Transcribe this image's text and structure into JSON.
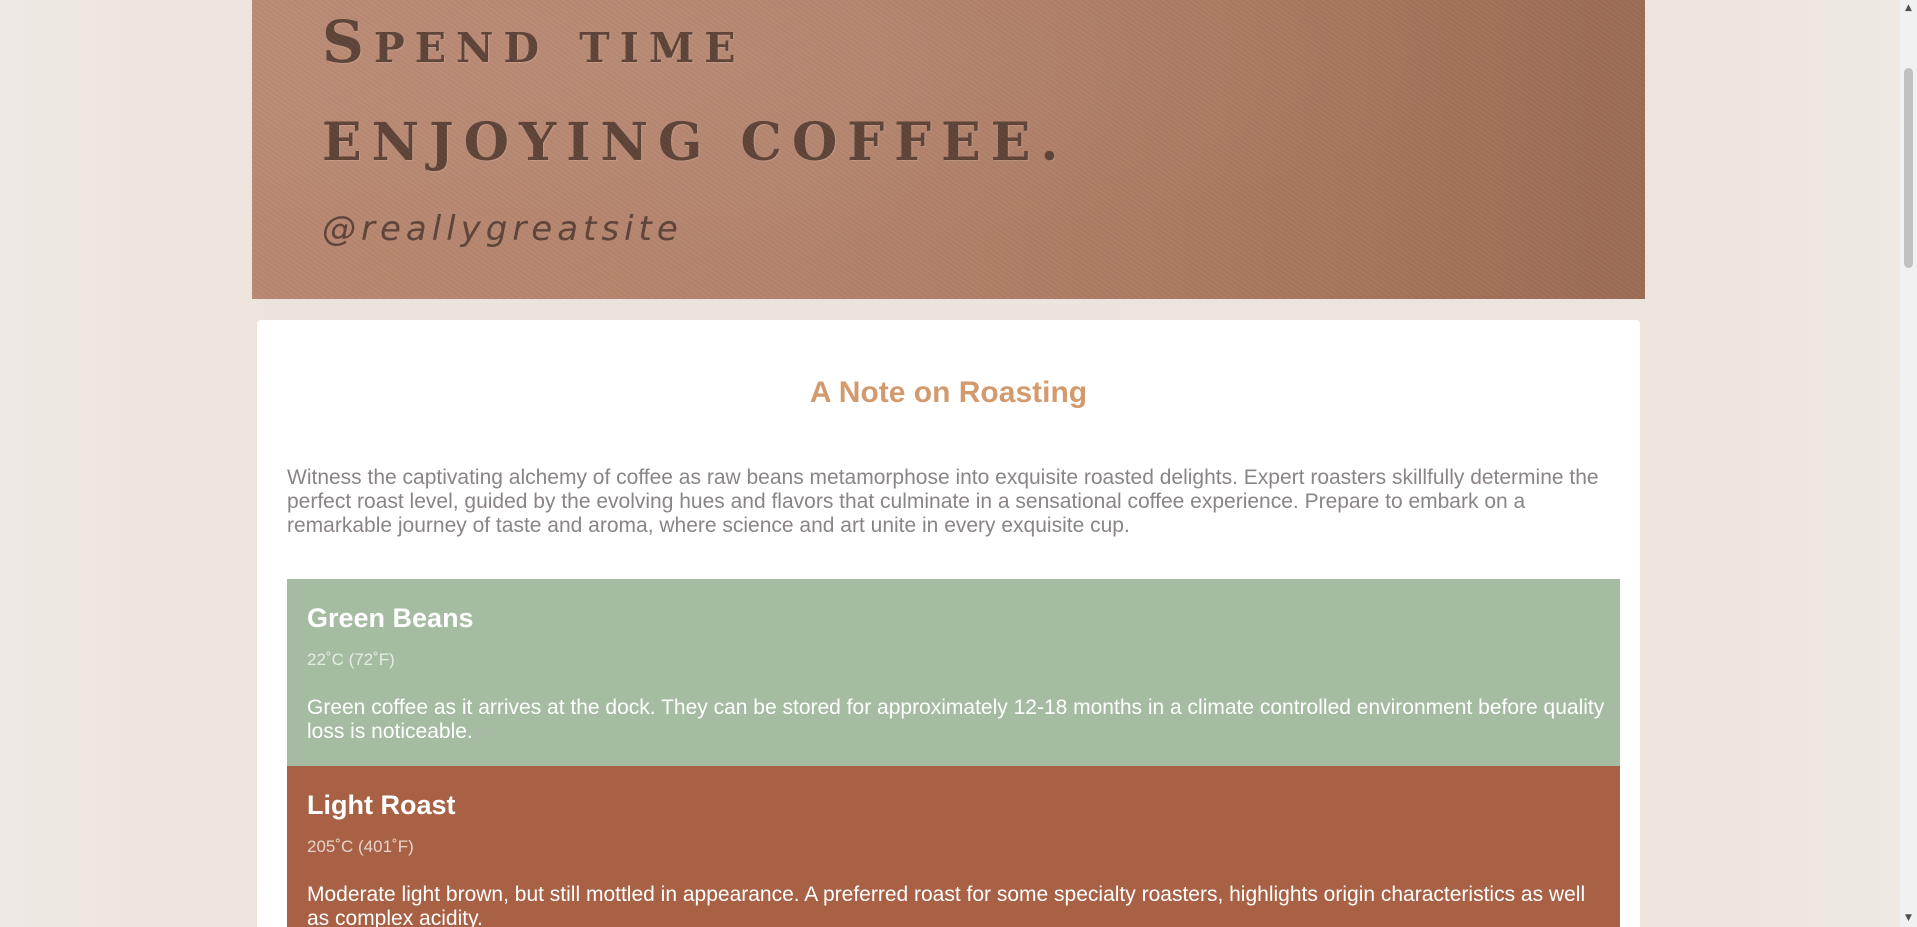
{
  "hero": {
    "line1": "Spend time",
    "line2": "enjoying coffee.",
    "handle": "@reallygreatsite"
  },
  "note": {
    "title": "A Note on Roasting",
    "intro": "Witness the captivating alchemy of coffee as raw beans metamorphose into exquisite roasted delights. Expert roasters skillfully determine the perfect roast level, guided by the evolving hues and flavors that culminate in a sensational coffee experience. Prepare to embark on a remarkable journey of taste and aroma, where science and art unite in every exquisite cup."
  },
  "stages": [
    {
      "name": "Green Beans",
      "temp": "22˚C (72˚F)",
      "description": "Green coffee as it arrives at the dock. They can be stored for approximately 12-18 months in a climate controlled environment before quality loss is noticeable.",
      "color": "#a5bca2"
    },
    {
      "name": "Light Roast",
      "temp": "205˚C (401˚F)",
      "description": "Moderate light brown, but still mottled in appearance. A preferred roast for some specialty roasters, highlights origin characteristics as well as complex acidity.",
      "color": "#a86144"
    }
  ],
  "colors": {
    "page_background": "#ece4dd",
    "title_accent": "#d39a6e",
    "hero_text": "#5e4338"
  },
  "scrollbar": {
    "up_icon": "triangle-up-icon",
    "down_icon": "triangle-down-icon"
  }
}
